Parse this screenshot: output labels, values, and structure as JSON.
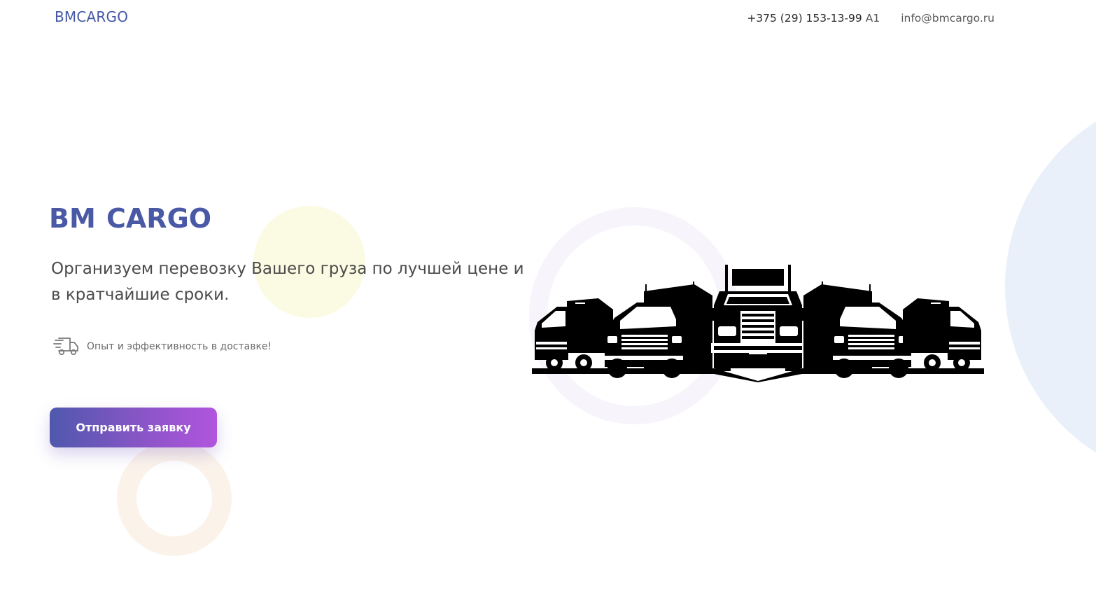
{
  "header": {
    "brand": "BMCARGO",
    "phone": "+375 (29) 153-13-99",
    "phone_operator": "A1",
    "email": "info@bmcargo.ru"
  },
  "hero": {
    "title": "BM CARGO",
    "subtitle": "Организуем перевозку Вашего груза по лучшей цене и в кратчайшие сроки.",
    "feature_text": "Опыт и эффективность в доставке!",
    "feature_icon": "delivery-truck-icon",
    "cta_label": "Отправить заявку",
    "illustration": "truck-fleet-illustration"
  },
  "colors": {
    "brand": "#4557a5",
    "cta_gradient_start": "#4f58ad",
    "cta_gradient_end": "#b155de",
    "deco_blue": "#e9f0f9",
    "deco_yellow": "#fbfbe3"
  }
}
